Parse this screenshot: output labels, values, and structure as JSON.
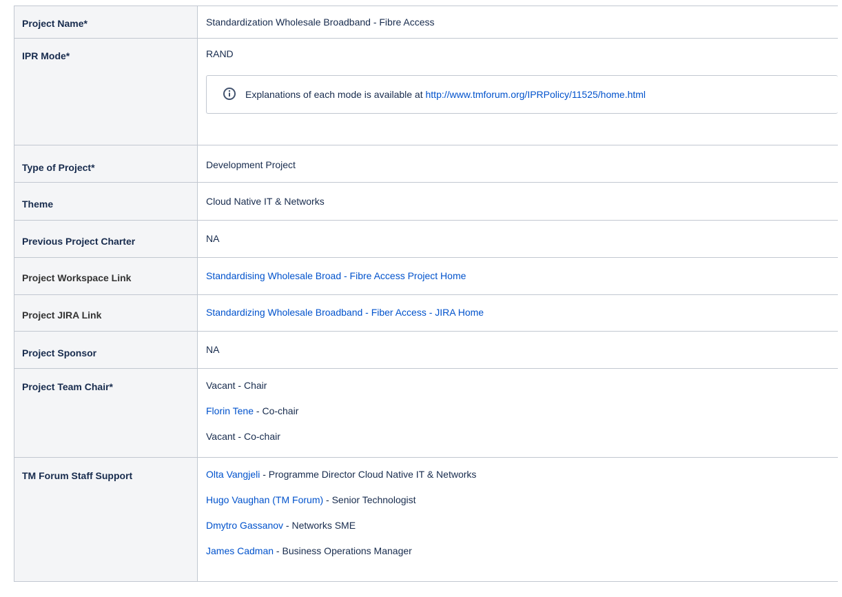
{
  "rows": {
    "project_name": {
      "label": "Project Name*",
      "value": "Standardization Wholesale Broadband - Fibre Access"
    },
    "ipr_mode": {
      "label": "IPR Mode*",
      "value": "RAND",
      "info": {
        "icon": "info-icon",
        "text": "Explanations of each mode is available at ",
        "link": "http://www.tmforum.org/IPRPolicy/11525/home.html"
      }
    },
    "type_of_project": {
      "label": "Type of Project*",
      "value": "Development Project"
    },
    "theme": {
      "label": "Theme",
      "value": "Cloud Native IT & Networks"
    },
    "previous_charter": {
      "label": "Previous Project Charter",
      "value": "NA"
    },
    "workspace_link": {
      "label": "Project Workspace Link",
      "link": "Standardising Wholesale Broad - Fibre Access Project Home"
    },
    "jira_link": {
      "label": "Project JIRA Link",
      "link": "Standardizing Wholesale Broadband - Fiber Access - JIRA Home"
    },
    "sponsor": {
      "label": "Project Sponsor",
      "value": "NA"
    },
    "team_chair": {
      "label": "Project Team Chair*",
      "entries": [
        {
          "name": "",
          "text": "Vacant - Chair"
        },
        {
          "name": "Florin Tene",
          "text": " - Co-chair"
        },
        {
          "name": "",
          "text": "Vacant - Co-chair"
        }
      ]
    },
    "staff_support": {
      "label": "TM Forum Staff Support",
      "entries": [
        {
          "name": "Olta Vangjeli",
          "text": " - Programme Director Cloud Native IT & Networks"
        },
        {
          "name": "Hugo Vaughan (TM Forum)",
          "text": " - Senior Technologist"
        },
        {
          "name": "Dmytro Gassanov",
          "text": " - Networks SME"
        },
        {
          "name": "James Cadman",
          "text": " - Business Operations Manager"
        }
      ]
    }
  },
  "colors": {
    "link": "#0052cc",
    "header_bg": "#f4f5f7",
    "border": "#c1c7d0",
    "text": "#172b4d"
  }
}
